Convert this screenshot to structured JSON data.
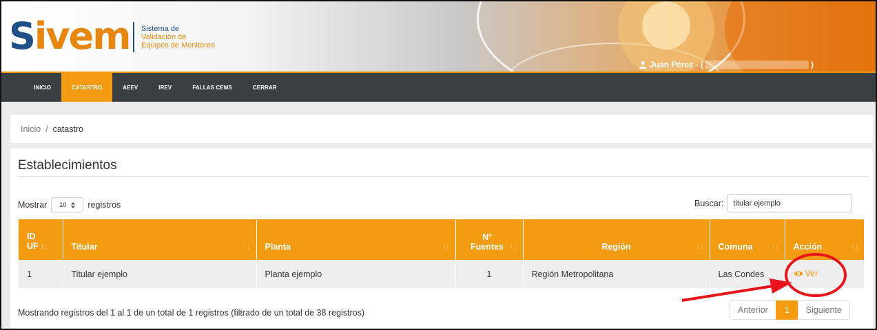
{
  "header": {
    "logo": "Sivem",
    "subtitle_line1": "Sistema de",
    "subtitle_line2": "Validación de",
    "subtitle_line3": "Equipos de Monitoreo",
    "user_label": "Juan Pérez - (",
    "user_close": ")"
  },
  "nav": {
    "items": [
      {
        "label": "INICIO"
      },
      {
        "label": "CATASTRO"
      },
      {
        "label": "AEEV"
      },
      {
        "label": "IREV"
      },
      {
        "label": "FALLAS CEMS"
      },
      {
        "label": "CERRAR"
      }
    ],
    "active": "CATASTRO"
  },
  "breadcrumb": {
    "home": "Inicio",
    "separator": "/",
    "current": "catastro"
  },
  "panel": {
    "title": "Establecimientos",
    "show_label": "Mostrar",
    "show_value": "10",
    "show_suffix": "registros",
    "search_label": "Buscar:",
    "search_value": "titular ejemplo"
  },
  "table": {
    "headers": {
      "id_line1": "ID",
      "id_line2": "UF",
      "titular": "Titular",
      "planta": "Planta",
      "fuentes_line1": "N°",
      "fuentes_line2": "Fuentes",
      "region": "Región",
      "comuna": "Comuna",
      "accion": "Acción"
    },
    "rows": [
      {
        "id": "1",
        "titular": "Titular ejemplo",
        "planta": "Planta ejemplo",
        "fuentes": "1",
        "region": "Región Metropolitana",
        "comuna": "Las Condes",
        "accion": "Ver"
      }
    ]
  },
  "footer": {
    "info": "Mostrando registros del 1 al 1 de un total de 1 registros (filtrado de un total de 38 registros)",
    "prev": "Anterior",
    "page": "1",
    "next": "Siguiente"
  },
  "colors": {
    "accent": "#f39c12",
    "nav_bg": "#3a3f44",
    "annotation": "#e8141c"
  },
  "icons": {
    "user": "user-icon",
    "eye": "eye-icon",
    "select_caret": "updown-caret-icon"
  }
}
